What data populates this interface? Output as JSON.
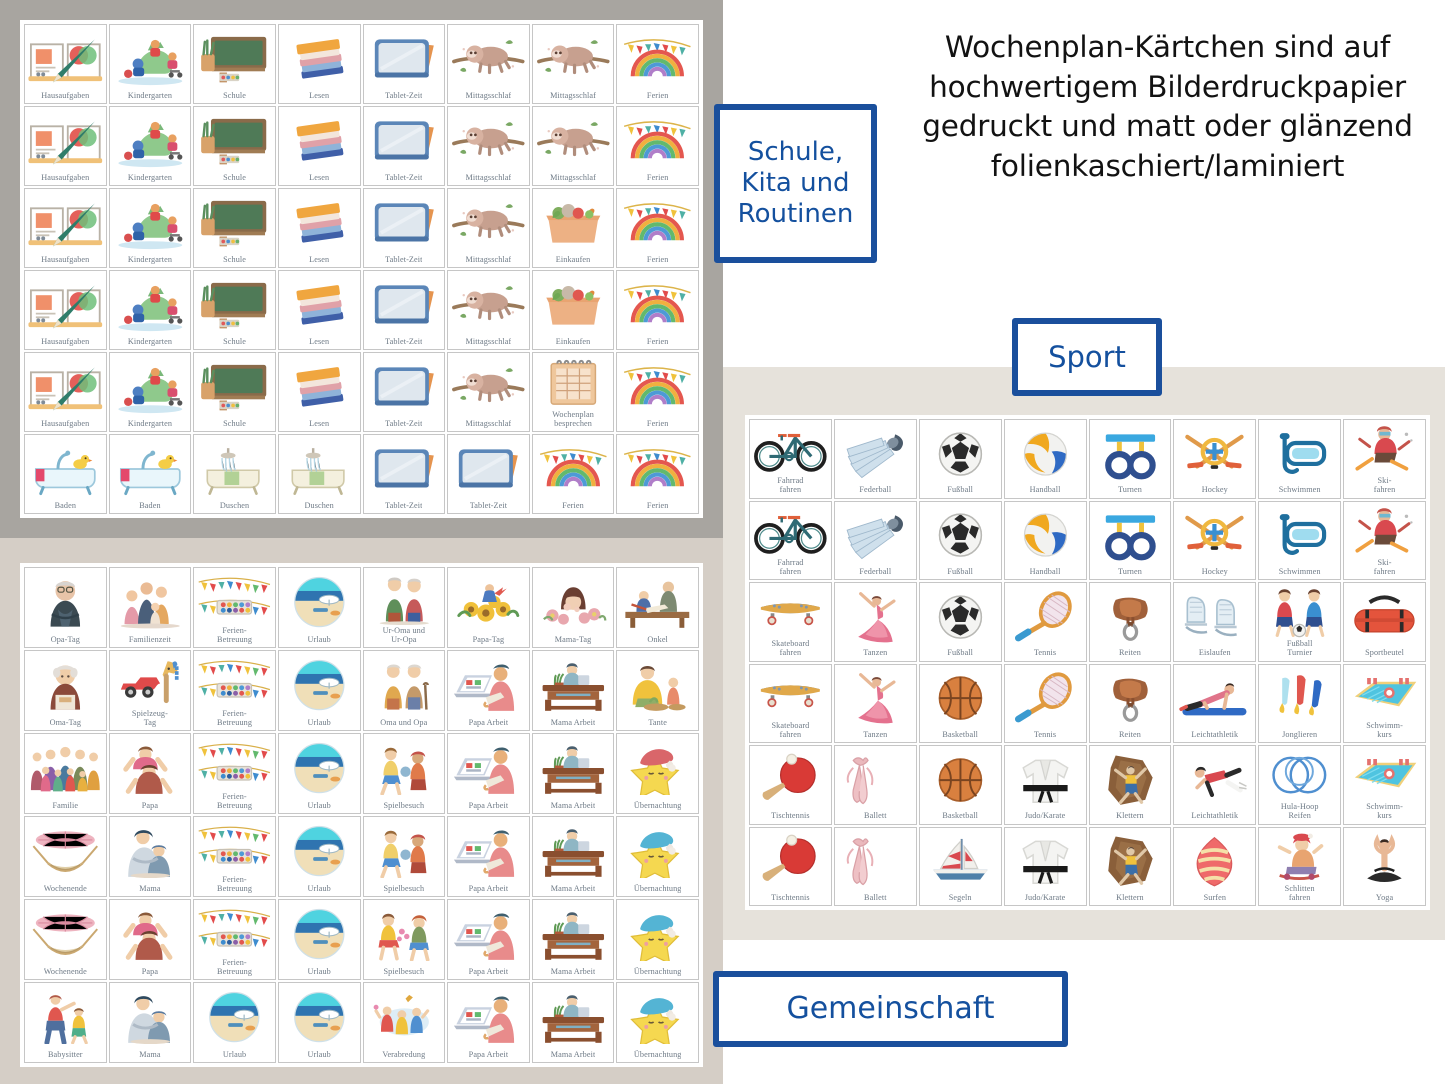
{
  "headline": "Wochenplan-Kärtchen sind auf hochwertigem Bilderdruckpapier gedruckt und matt oder glänzend folienkaschiert/laminiert",
  "signs": {
    "routines": "Schule,\nKita und\nRoutinen",
    "sport": "Sport",
    "community": "Gemeinschaft"
  },
  "colors": {
    "sign_blue": "#14509e",
    "sign_border": "#1a4f9c",
    "card_label": "#6e7a86",
    "card_border": "#c6c6c6",
    "bg_grey": "#a8a5a0",
    "bg_beige": "#d5cec6",
    "bg_beige_light": "#e6e2db",
    "sheet_white": "#ffffff"
  },
  "sheets": {
    "routines": {
      "name": "Schule, Kita und Routinen",
      "columns": 8,
      "rows": 6,
      "cards": [
        {
          "label": "Hausaufgaben",
          "icon": "open-book-pencil-icon"
        },
        {
          "label": "Kindergarten",
          "icon": "kids-playground-dino-icon"
        },
        {
          "label": "Schule",
          "icon": "chalkboard-icon"
        },
        {
          "label": "Lesen",
          "icon": "book-stack-icon"
        },
        {
          "label": "Tablet-Zeit",
          "icon": "tablet-icon"
        },
        {
          "label": "Mittagsschlaf",
          "icon": "sloth-icon"
        },
        {
          "label": "Mittagsschlaf",
          "icon": "sloth-icon"
        },
        {
          "label": "Ferien",
          "icon": "rainbow-bunting-icon"
        },
        {
          "label": "Hausaufgaben",
          "icon": "open-book-pencil-icon"
        },
        {
          "label": "Kindergarten",
          "icon": "kids-playground-dino-icon"
        },
        {
          "label": "Schule",
          "icon": "chalkboard-icon"
        },
        {
          "label": "Lesen",
          "icon": "book-stack-icon"
        },
        {
          "label": "Tablet-Zeit",
          "icon": "tablet-icon"
        },
        {
          "label": "Mittagsschlaf",
          "icon": "sloth-icon"
        },
        {
          "label": "Mittagsschlaf",
          "icon": "sloth-icon"
        },
        {
          "label": "Ferien",
          "icon": "rainbow-bunting-icon"
        },
        {
          "label": "Hausaufgaben",
          "icon": "open-book-pencil-icon"
        },
        {
          "label": "Kindergarten",
          "icon": "kids-playground-dino-icon"
        },
        {
          "label": "Schule",
          "icon": "chalkboard-icon"
        },
        {
          "label": "Lesen",
          "icon": "book-stack-icon"
        },
        {
          "label": "Tablet-Zeit",
          "icon": "tablet-icon"
        },
        {
          "label": "Mittagsschlaf",
          "icon": "sloth-icon"
        },
        {
          "label": "Einkaufen",
          "icon": "grocery-box-icon"
        },
        {
          "label": "Ferien",
          "icon": "rainbow-bunting-icon"
        },
        {
          "label": "Hausaufgaben",
          "icon": "open-book-pencil-icon"
        },
        {
          "label": "Kindergarten",
          "icon": "kids-playground-dino-icon"
        },
        {
          "label": "Schule",
          "icon": "chalkboard-icon"
        },
        {
          "label": "Lesen",
          "icon": "book-stack-icon"
        },
        {
          "label": "Tablet-Zeit",
          "icon": "tablet-icon"
        },
        {
          "label": "Mittagsschlaf",
          "icon": "sloth-icon"
        },
        {
          "label": "Einkaufen",
          "icon": "grocery-box-icon"
        },
        {
          "label": "Ferien",
          "icon": "rainbow-bunting-icon"
        },
        {
          "label": "Hausaufgaben",
          "icon": "open-book-pencil-icon"
        },
        {
          "label": "Kindergarten",
          "icon": "kids-playground-dino-icon"
        },
        {
          "label": "Schule",
          "icon": "chalkboard-icon"
        },
        {
          "label": "Lesen",
          "icon": "book-stack-icon"
        },
        {
          "label": "Tablet-Zeit",
          "icon": "tablet-icon"
        },
        {
          "label": "Mittagsschlaf",
          "icon": "sloth-icon"
        },
        {
          "label": "Wochenplan\nbesprechen",
          "icon": "notepad-icon"
        },
        {
          "label": "Ferien",
          "icon": "rainbow-bunting-icon"
        },
        {
          "label": "Baden",
          "icon": "bathtub-duck-icon"
        },
        {
          "label": "Baden",
          "icon": "bathtub-duck-icon"
        },
        {
          "label": "Duschen",
          "icon": "shower-tub-icon"
        },
        {
          "label": "Duschen",
          "icon": "shower-tub-icon"
        },
        {
          "label": "Tablet-Zeit",
          "icon": "tablet-icon"
        },
        {
          "label": "Tablet-Zeit",
          "icon": "tablet-icon"
        },
        {
          "label": "Ferien",
          "icon": "rainbow-bunting-icon"
        },
        {
          "label": "Ferien",
          "icon": "rainbow-bunting-icon"
        }
      ]
    },
    "community": {
      "name": "Gemeinschaft",
      "columns": 8,
      "rows": 6,
      "cards": [
        {
          "label": "Opa-Tag",
          "icon": "grandfather-icon"
        },
        {
          "label": "Familienzeit",
          "icon": "family-sitting-icon"
        },
        {
          "label": "Ferien-\nBetreuung",
          "icon": "bunting-paints-icon"
        },
        {
          "label": "Urlaub",
          "icon": "beach-circle-icon"
        },
        {
          "label": "Ur-Oma und\nUr-Opa",
          "icon": "great-grandparents-icon"
        },
        {
          "label": "Papa-Tag",
          "icon": "sunflower-papa-icon"
        },
        {
          "label": "Mama-Tag",
          "icon": "mother-flowers-icon"
        },
        {
          "label": "Onkel",
          "icon": "uncle-child-icon"
        },
        {
          "label": "Oma-Tag",
          "icon": "grandmother-icon"
        },
        {
          "label": "Spielzeug-\nTag",
          "icon": "toy-car-horse-icon"
        },
        {
          "label": "Ferien-\nBetreuung",
          "icon": "bunting-paints-icon"
        },
        {
          "label": "Urlaub",
          "icon": "beach-circle-icon"
        },
        {
          "label": "Oma und Opa",
          "icon": "grandparents-icon"
        },
        {
          "label": "Papa Arbeit",
          "icon": "papa-laptop-icon"
        },
        {
          "label": "Mama Arbeit",
          "icon": "mama-desk-icon"
        },
        {
          "label": "Tante",
          "icon": "aunt-child-icon"
        },
        {
          "label": "Familie",
          "icon": "big-family-icon"
        },
        {
          "label": "Papa",
          "icon": "papa-shoulders-icon"
        },
        {
          "label": "Ferien-\nBetreuung",
          "icon": "bunting-paints-icon"
        },
        {
          "label": "Urlaub",
          "icon": "beach-circle-icon"
        },
        {
          "label": "Spielbesuch",
          "icon": "two-kids-play-icon"
        },
        {
          "label": "Papa Arbeit",
          "icon": "papa-laptop-icon"
        },
        {
          "label": "Mama Arbeit",
          "icon": "mama-desk-icon"
        },
        {
          "label": "Übernachtung",
          "icon": "sleeping-star-red-icon"
        },
        {
          "label": "Wochenende",
          "icon": "hammock-icon"
        },
        {
          "label": "Mama",
          "icon": "mama-hug-icon"
        },
        {
          "label": "Ferien-\nBetreuung",
          "icon": "bunting-paints-icon"
        },
        {
          "label": "Urlaub",
          "icon": "beach-circle-icon"
        },
        {
          "label": "Spielbesuch",
          "icon": "two-kids-play-icon"
        },
        {
          "label": "Papa Arbeit",
          "icon": "papa-laptop-icon"
        },
        {
          "label": "Mama Arbeit",
          "icon": "mama-desk-icon"
        },
        {
          "label": "Übernachtung",
          "icon": "sleeping-star-blue-icon"
        },
        {
          "label": "Wochenende",
          "icon": "hammock-icon"
        },
        {
          "label": "Papa",
          "icon": "papa-shoulders-icon"
        },
        {
          "label": "Ferien-\nBetreuung",
          "icon": "bunting-paints-icon"
        },
        {
          "label": "Urlaub",
          "icon": "beach-circle-icon"
        },
        {
          "label": "Spielbesuch",
          "icon": "two-kids-flowers-icon"
        },
        {
          "label": "Papa Arbeit",
          "icon": "papa-laptop-icon"
        },
        {
          "label": "Mama Arbeit",
          "icon": "mama-desk-icon"
        },
        {
          "label": "Übernachtung",
          "icon": "sleeping-star-blue-icon"
        },
        {
          "label": "Babysitter",
          "icon": "babysitter-icon"
        },
        {
          "label": "Mama",
          "icon": "mama-hug-icon"
        },
        {
          "label": "Urlaub",
          "icon": "beach-circle-icon"
        },
        {
          "label": "Urlaub",
          "icon": "beach-circle-icon"
        },
        {
          "label": "Verabredung",
          "icon": "kids-party-icon"
        },
        {
          "label": "Papa Arbeit",
          "icon": "papa-laptop-icon"
        },
        {
          "label": "Mama Arbeit",
          "icon": "mama-desk-icon"
        },
        {
          "label": "Übernachtung",
          "icon": "sleeping-star-blue-icon"
        }
      ]
    },
    "sport": {
      "name": "Sport",
      "columns": 8,
      "rows": 6,
      "cards": [
        {
          "label": "Fahrrad\nfahren",
          "icon": "bicycle-icon"
        },
        {
          "label": "Federball",
          "icon": "shuttlecock-icon"
        },
        {
          "label": "Fußball",
          "icon": "soccer-ball-icon"
        },
        {
          "label": "Handball",
          "icon": "handball-icon"
        },
        {
          "label": "Turnen",
          "icon": "gym-rings-icon"
        },
        {
          "label": "Hockey",
          "icon": "hockey-sticks-icon"
        },
        {
          "label": "Schwimmen",
          "icon": "snorkel-mask-icon"
        },
        {
          "label": "Ski-\nfahren",
          "icon": "skier-icon"
        },
        {
          "label": "Fahrrad\nfahren",
          "icon": "bicycle-icon"
        },
        {
          "label": "Federball",
          "icon": "shuttlecock-icon"
        },
        {
          "label": "Fußball",
          "icon": "soccer-ball-icon"
        },
        {
          "label": "Handball",
          "icon": "handball-icon"
        },
        {
          "label": "Turnen",
          "icon": "gym-rings-icon"
        },
        {
          "label": "Hockey",
          "icon": "hockey-sticks-icon"
        },
        {
          "label": "Schwimmen",
          "icon": "snorkel-mask-icon"
        },
        {
          "label": "Ski-\nfahren",
          "icon": "skier-icon"
        },
        {
          "label": "Skateboard\nfahren",
          "icon": "skateboard-icon"
        },
        {
          "label": "Tanzen",
          "icon": "dancer-icon"
        },
        {
          "label": "Fußball",
          "icon": "soccer-ball-icon"
        },
        {
          "label": "Tennis",
          "icon": "tennis-racket-icon"
        },
        {
          "label": "Reiten",
          "icon": "saddle-icon"
        },
        {
          "label": "Eislaufen",
          "icon": "ice-skates-icon"
        },
        {
          "label": "Fußball\nTurnier",
          "icon": "two-boys-soccer-icon"
        },
        {
          "label": "Sportbeutel",
          "icon": "sports-bag-icon"
        },
        {
          "label": "Skateboard\nfahren",
          "icon": "skateboard-icon"
        },
        {
          "label": "Tanzen",
          "icon": "dancer-icon"
        },
        {
          "label": "Basketball",
          "icon": "basketball-icon"
        },
        {
          "label": "Tennis",
          "icon": "tennis-racket-icon"
        },
        {
          "label": "Reiten",
          "icon": "saddle-icon"
        },
        {
          "label": "Leichtathletik",
          "icon": "plank-athlete-icon"
        },
        {
          "label": "Jonglieren",
          "icon": "juggling-clubs-icon"
        },
        {
          "label": "Schwimm-\nkurs",
          "icon": "swimming-pool-icon"
        },
        {
          "label": "Tischtennis",
          "icon": "table-tennis-icon"
        },
        {
          "label": "Ballett",
          "icon": "ballet-shoes-icon"
        },
        {
          "label": "Basketball",
          "icon": "basketball-icon"
        },
        {
          "label": "Judo/Karate",
          "icon": "judo-gi-icon"
        },
        {
          "label": "Klettern",
          "icon": "climber-icon"
        },
        {
          "label": "Leichtathletik",
          "icon": "high-jump-icon"
        },
        {
          "label": "Hula-Hoop\nReifen",
          "icon": "hula-hoop-icon"
        },
        {
          "label": "Schwimm-\nkurs",
          "icon": "swimming-pool-icon"
        },
        {
          "label": "Tischtennis",
          "icon": "table-tennis-icon"
        },
        {
          "label": "Ballett",
          "icon": "ballet-shoes-icon"
        },
        {
          "label": "Segeln",
          "icon": "sailboat-icon"
        },
        {
          "label": "Judo/Karate",
          "icon": "judo-gi-icon"
        },
        {
          "label": "Klettern",
          "icon": "climber-icon"
        },
        {
          "label": "Surfen",
          "icon": "surfboard-icon"
        },
        {
          "label": "Schlitten\nfahren",
          "icon": "sled-child-icon"
        },
        {
          "label": "Yoga",
          "icon": "yoga-pose-icon"
        }
      ]
    }
  }
}
